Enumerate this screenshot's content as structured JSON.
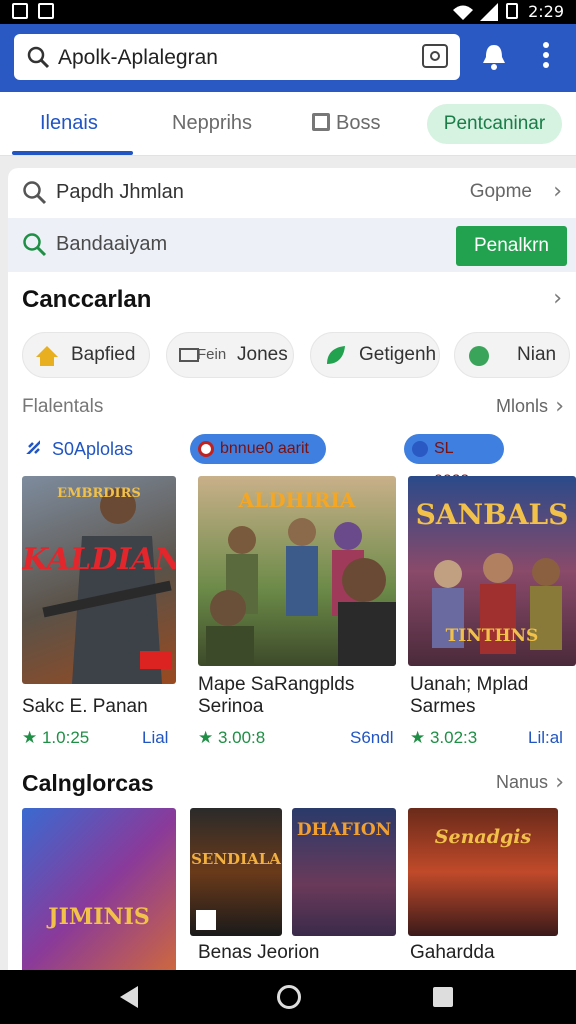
{
  "status_bar": {
    "time": "2:29"
  },
  "app_bar": {
    "search_text": "Apolk-Aplalegran"
  },
  "tabs": [
    {
      "label": "Ilenais",
      "active": true
    },
    {
      "label": "Nepprihs",
      "active": false
    },
    {
      "label": "Boss",
      "active": false
    },
    {
      "label": "Pentcaninar",
      "active": false
    }
  ],
  "search_row": {
    "text": "Papdh Jhmlan",
    "right": "Gopme"
  },
  "filter_row": {
    "text": "Bandaaiyam",
    "button": "Penalkrn"
  },
  "section1": {
    "title": "Canccarlan"
  },
  "chips": [
    {
      "label": "Bapfied",
      "icon": "house-icon"
    },
    {
      "label": "Jones",
      "prefix": "Fein",
      "icon": "card-icon"
    },
    {
      "label": "Getigenh",
      "icon": "leaf-icon"
    },
    {
      "label": "Nian",
      "icon": "globe-icon"
    }
  ],
  "subsection": {
    "title": "Flalentals",
    "more": "Mlonls"
  },
  "badges": [
    {
      "label": "S0Aplolas",
      "icon": "link-icon"
    },
    {
      "label": "bnnue0 aarit",
      "icon": "circle-icon"
    },
    {
      "label": "SL eeas",
      "icon": "bolt-icon"
    }
  ],
  "games": [
    {
      "art_text": "KALDIAN",
      "art_top": "EMBRDIRS",
      "title_line1": "Sakc E. Panan",
      "title_line2": "",
      "rating": "1.0:25",
      "status": "Lial"
    },
    {
      "art_text": "ALDHIRIA",
      "art_top": "",
      "title_line1": "Mape SaRangplds",
      "title_line2": "Serinoa",
      "rating": "3.00:8",
      "status": "S6ndl"
    },
    {
      "art_text": "SANBALS",
      "art_top": "",
      "art_bottom": "TINTHNS",
      "title_line1": "Uanah; Mplad",
      "title_line2": "Sarmes",
      "rating": "3.02:3",
      "status": "Lil:al"
    }
  ],
  "section2": {
    "title": "Calnglorcas",
    "more": "Nanus"
  },
  "categories": [
    {
      "art_text": "JIMINIS",
      "title": ""
    },
    {
      "art_text": "SENDIALA",
      "title": "Benas Jeorion"
    },
    {
      "art_text": "DHAFION",
      "title": ""
    },
    {
      "art_text": "Senadgis",
      "title": "Gahardda"
    }
  ]
}
